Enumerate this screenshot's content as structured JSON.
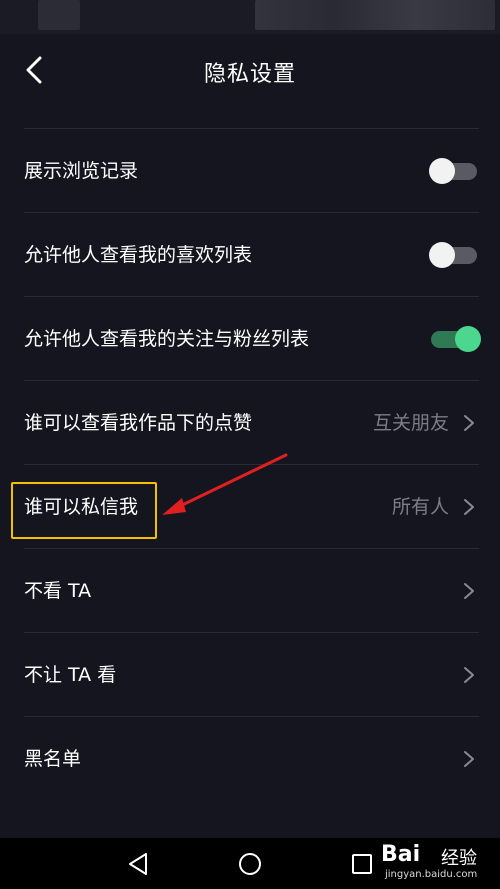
{
  "header": {
    "title": "隐私设置"
  },
  "rows": [
    {
      "label": "展示浏览记录",
      "toggle": "off"
    },
    {
      "label": "允许他人查看我的喜欢列表",
      "toggle": "off"
    },
    {
      "label": "允许他人查看我的关注与粉丝列表",
      "toggle": "on"
    },
    {
      "label": "谁可以查看我作品下的点赞",
      "value": "互关朋友"
    },
    {
      "label": "谁可以私信我",
      "value": "所有人"
    },
    {
      "label": "不看 TA"
    },
    {
      "label": "不让 TA 看"
    },
    {
      "label": "黑名单"
    }
  ],
  "watermark": {
    "logo": "Bai",
    "logo_tail": "经验",
    "url": "jingyan.baidu.com"
  },
  "colors": {
    "toggle_on": "#4bd88e",
    "highlight": "#f5c000",
    "arrow": "#e02020",
    "background": "#15151f"
  }
}
